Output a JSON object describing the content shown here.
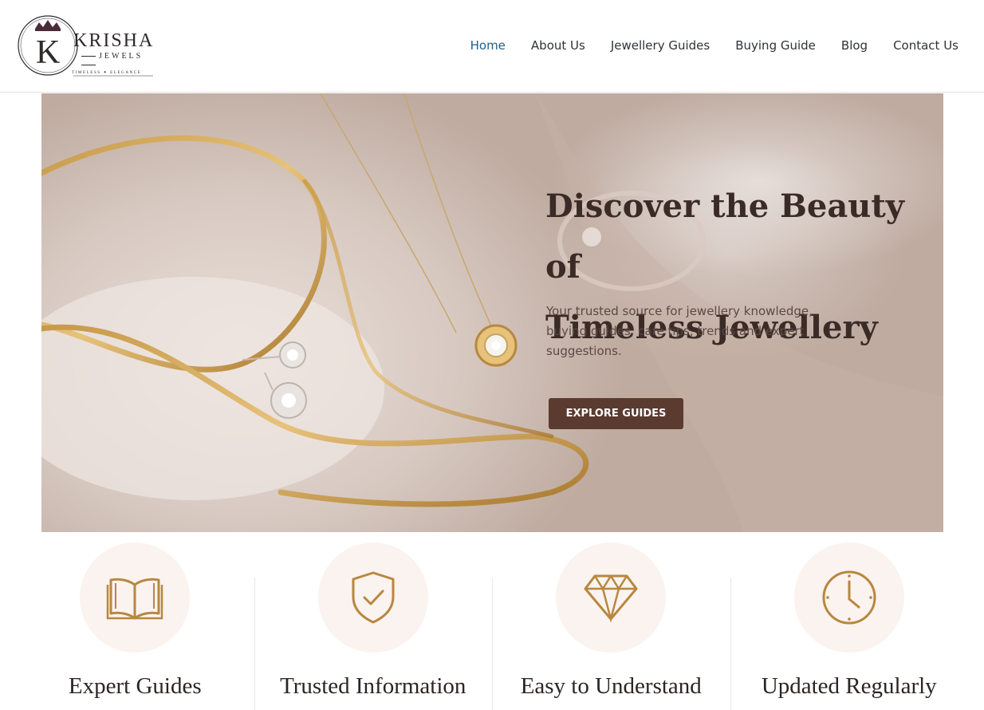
{
  "brand": {
    "name": "KRISHA",
    "sub": "JEWELS",
    "tagline": "TIMELESS ✦ ELEGANCE",
    "monogram": "K"
  },
  "nav": {
    "items": [
      {
        "label": "Home",
        "active": true
      },
      {
        "label": "About Us"
      },
      {
        "label": "Jewellery Guides"
      },
      {
        "label": "Buying Guide"
      },
      {
        "label": "Blog"
      },
      {
        "label": "Contact Us"
      }
    ]
  },
  "hero": {
    "title_line1": "Discover the Beauty of",
    "title_line2": "Timeless Jewellery",
    "description": "Your trusted source for jewellery knowledge, buying guides, care tips, trends and expert suggestions.",
    "button_label": "EXPLORE GUIDES"
  },
  "features": [
    {
      "title": "Expert Guides",
      "icon": "open-book-icon"
    },
    {
      "title": "Trusted Information",
      "icon": "shield-check-icon"
    },
    {
      "title": "Easy to Understand",
      "icon": "diamond-icon"
    },
    {
      "title": "Updated Regularly",
      "icon": "clock-icon"
    }
  ],
  "colors": {
    "accent_link": "#1d5f8f",
    "button_bg": "#5b3b2f",
    "icon_gold": "#b8873f",
    "feature_circle": "#faf3ef"
  }
}
